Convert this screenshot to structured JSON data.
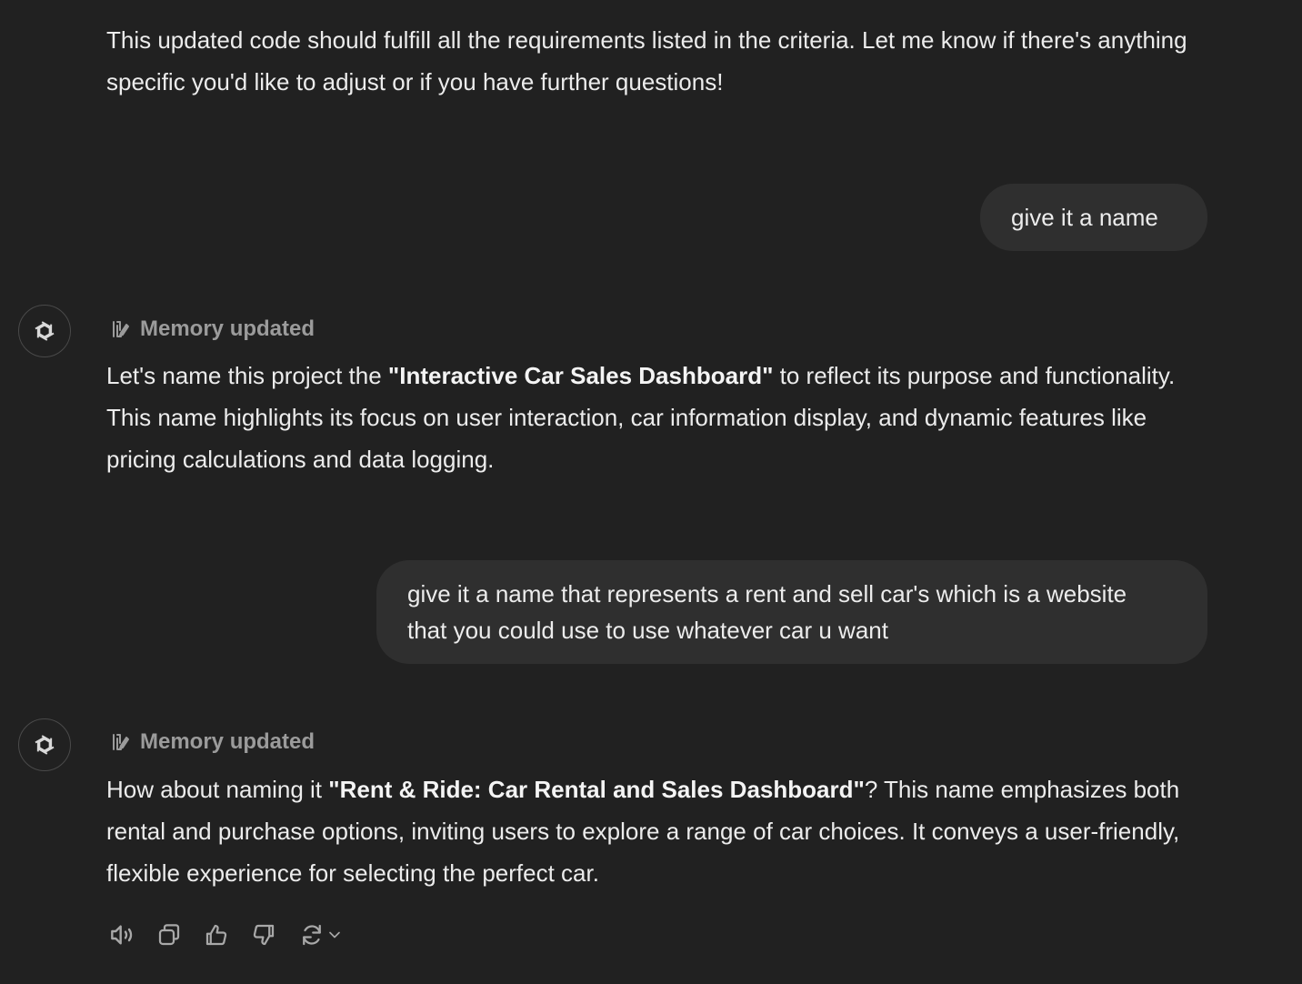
{
  "messages": {
    "assistant_0": {
      "text": "This updated code should fulfill all the requirements listed in the criteria. Let me know if there's anything specific you'd like to adjust or if you have further questions!"
    },
    "user_1": {
      "text": "give it a name"
    },
    "assistant_1": {
      "memory_label": "Memory updated",
      "before": "Let's name this project the ",
      "bold": "\"Interactive Car Sales Dashboard\"",
      "after": " to reflect its purpose and functionality. This name highlights its focus on user interaction, car information display, and dynamic features like pricing calculations and data logging."
    },
    "user_2": {
      "text": "give it a name that represents a rent and sell car's which is a website that you could use to use whatever car u want"
    },
    "assistant_2": {
      "memory_label": "Memory updated",
      "before": "How about naming it ",
      "bold": "\"Rent & Ride: Car Rental and Sales Dashboard\"",
      "after": "? This name emphasizes both rental and purchase options, inviting users to explore a range of car choices. It conveys a user-friendly, flexible experience for selecting the perfect car."
    }
  },
  "actions": [
    "read-aloud-icon",
    "copy-icon",
    "thumbs-up-icon",
    "thumbs-down-icon",
    "regenerate-icon"
  ],
  "colors": {
    "background": "#212121",
    "bubble": "#2f2f2f",
    "text": "#ececec",
    "muted": "#9b9b9b"
  }
}
